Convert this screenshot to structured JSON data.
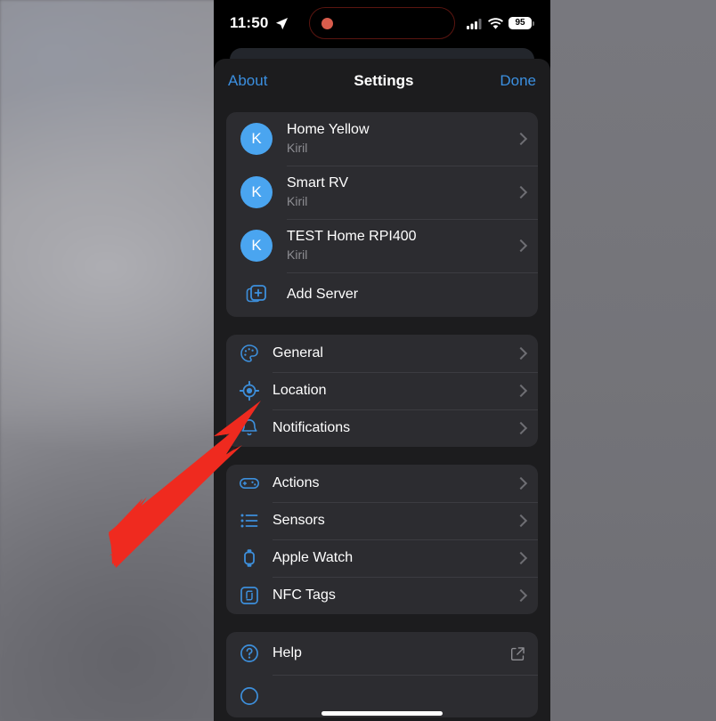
{
  "status_bar": {
    "time": "11:50",
    "location_icon": "location-arrow-icon",
    "cellular_icon": "cellular-signal-icon",
    "wifi_icon": "wifi-icon",
    "battery_percent": "95",
    "recording_indicator": "screen-recording-dot"
  },
  "navbar": {
    "left_label": "About",
    "title": "Settings",
    "right_label": "Done"
  },
  "servers": {
    "items": [
      {
        "avatar_letter": "K",
        "name": "Home Yellow",
        "user": "Kiril"
      },
      {
        "avatar_letter": "K",
        "name": "Smart RV",
        "user": "Kiril"
      },
      {
        "avatar_letter": "K",
        "name": "TEST Home RPI400",
        "user": "Kiril"
      }
    ],
    "add_label": "Add Server",
    "add_icon": "add-server-icon"
  },
  "settings_group": {
    "items": [
      {
        "label": "General",
        "icon": "palette-icon"
      },
      {
        "label": "Location",
        "icon": "location-target-icon"
      },
      {
        "label": "Notifications",
        "icon": "bell-icon"
      }
    ]
  },
  "features_group": {
    "items": [
      {
        "label": "Actions",
        "icon": "gamepad-icon"
      },
      {
        "label": "Sensors",
        "icon": "list-bullet-icon"
      },
      {
        "label": "Apple Watch",
        "icon": "apple-watch-icon"
      },
      {
        "label": "NFC Tags",
        "icon": "nfc-tag-icon"
      }
    ]
  },
  "help_group": {
    "items": [
      {
        "label": "Help",
        "icon": "question-circle-icon",
        "trailing": "external-link-icon"
      }
    ]
  },
  "annotation": {
    "arrow_color": "#ef2a1f",
    "points_to": "Location"
  },
  "colors": {
    "accent": "#3b8fe0",
    "icon_blue": "#3d8fdb",
    "avatar_blue": "#4aa5f0",
    "card": "#2c2c30",
    "sheet": "#1c1c1e",
    "subtitle": "#8e8e93"
  }
}
